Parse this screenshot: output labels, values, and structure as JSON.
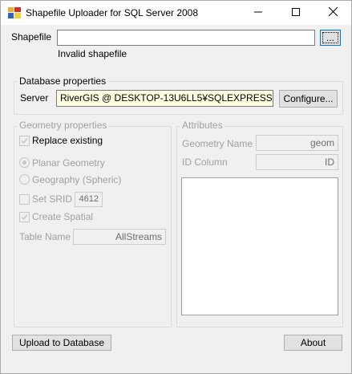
{
  "window": {
    "title": "Shapefile Uploader for SQL Server 2008"
  },
  "shapefile": {
    "label": "Shapefile",
    "value": "",
    "browse_label": "...",
    "status": "Invalid shapefile"
  },
  "database": {
    "group_title": "Database properties",
    "server_label": "Server",
    "server_value": "RiverGIS @ DESKTOP-13U6LL5¥SQLEXPRESS",
    "configure_label": "Configure..."
  },
  "geometry": {
    "group_title": "Geometry properties",
    "replace_existing": "Replace existing",
    "planar": "Planar Geometry",
    "geography": "Geography (Spheric)",
    "set_srid": "Set SRID",
    "srid_value": "4612",
    "create_spatial": "Create Spatial",
    "table_name_label": "Table Name",
    "table_name_value": "AllStreams"
  },
  "attributes": {
    "group_title": "Attributes",
    "geometry_name_label": "Geometry Name",
    "geometry_name_value": "geom",
    "id_column_label": "ID Column",
    "id_column_value": "ID"
  },
  "footer": {
    "upload_label": "Upload to Database",
    "about_label": "About"
  },
  "icons": {
    "app": "app-icon",
    "minimize": "minimize-icon",
    "maximize": "maximize-icon",
    "close": "close-icon",
    "check": "checkmark-icon"
  }
}
